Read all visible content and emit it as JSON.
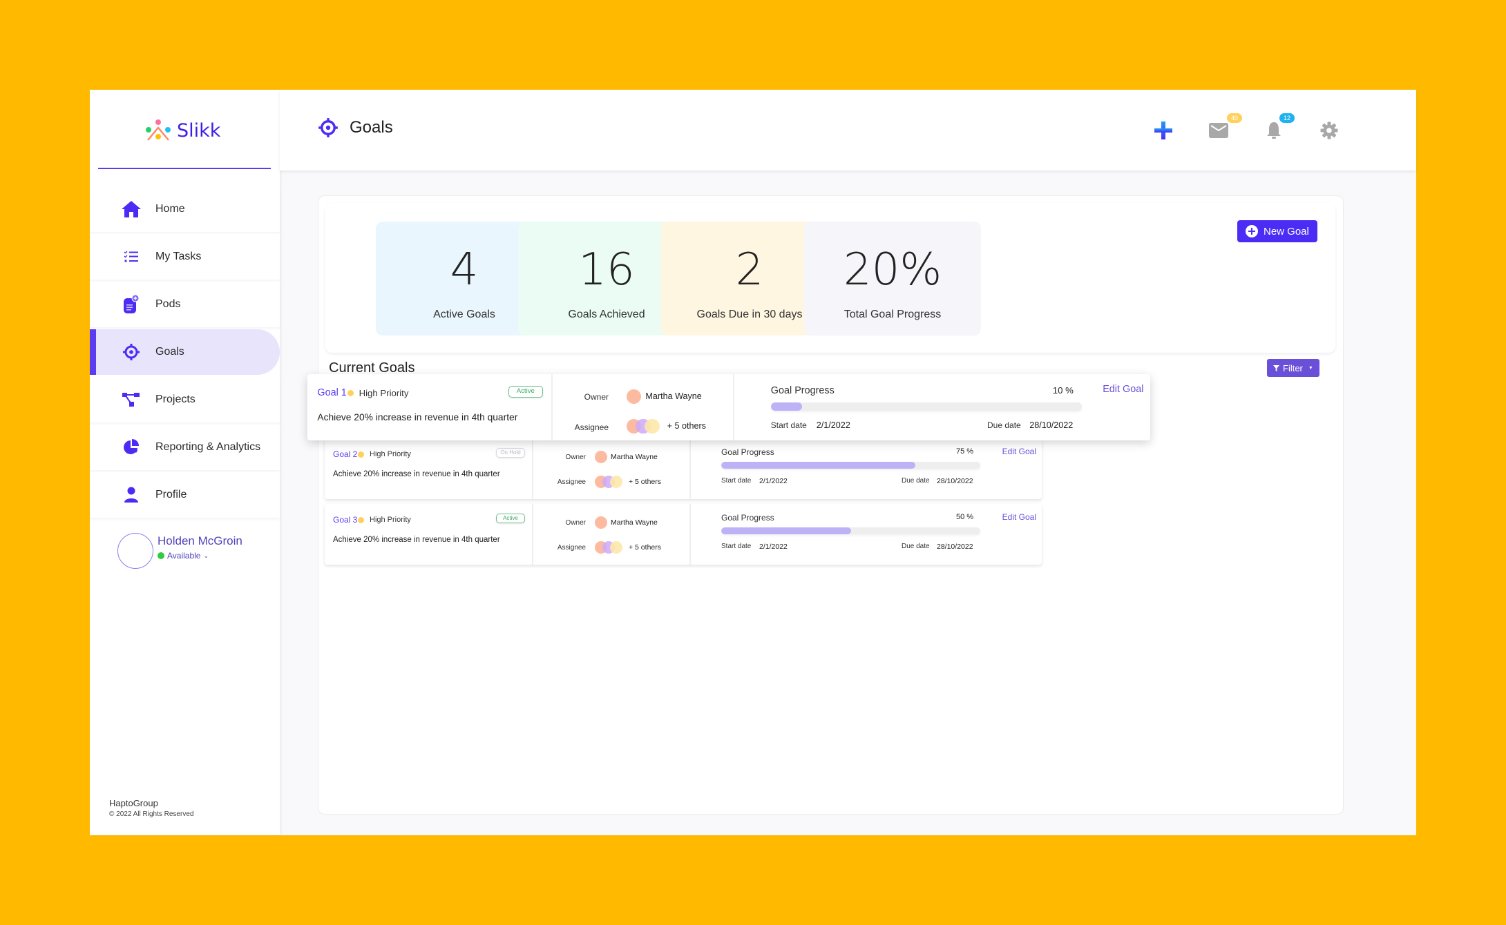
{
  "brand": {
    "name": "Slikk"
  },
  "sidebar": {
    "items": [
      {
        "label": "Home",
        "icon": "home-icon",
        "active": false
      },
      {
        "label": "My Tasks",
        "icon": "task-list-icon",
        "active": false
      },
      {
        "label": "Pods",
        "icon": "pods-icon",
        "active": false
      },
      {
        "label": "Goals",
        "icon": "target-icon",
        "active": true
      },
      {
        "label": "Projects",
        "icon": "hierarchy-icon",
        "active": false
      },
      {
        "label": "Reporting & Analytics",
        "icon": "pie-chart-icon",
        "active": false
      },
      {
        "label": "Profile",
        "icon": "person-icon",
        "active": false
      }
    ],
    "user": {
      "name": "Holden McGroin",
      "status": "Available",
      "status_color": "#2ECC40"
    },
    "footer": {
      "org": "HaptoGroup",
      "copyright": "2022 All Rights Reserved"
    }
  },
  "header": {
    "title": "Goals",
    "mail_badge": "40",
    "notifications_badge": "12"
  },
  "stats": [
    {
      "value": "4",
      "label": "Active Goals",
      "bg": "#EAF6FD"
    },
    {
      "value": "16",
      "label": "Goals Achieved",
      "bg": "#EAFCF3"
    },
    {
      "value": "2",
      "label": "Goals Due in 30 days",
      "bg": "#FEF6E0"
    },
    {
      "value": "20%",
      "label": "Total Goal Progress",
      "bg": "#F5F5FA"
    }
  ],
  "new_goal_label": "New Goal",
  "current_goals": {
    "title": "Current Goals",
    "filter_label": "Filter",
    "owner_label": "Owner",
    "assignee_label": "Assignee",
    "progress_label": "Goal Progress",
    "start_label": "Start date",
    "due_label": "Due date",
    "edit_label": "Edit Goal",
    "goals": [
      {
        "name": "Goal 1",
        "priority": "High Priority",
        "status": "Active",
        "description": "Achieve 20% increase in revenue in 4th quarter",
        "owner": "Martha Wayne",
        "assignees_more": "+ 5 others",
        "progress": 10,
        "progress_text": "10 %",
        "start_date": "2/1/2022",
        "due_date": "28/10/2022"
      },
      {
        "name": "Goal 2",
        "priority": "High Priority",
        "status": "On Hold",
        "description": "Achieve 20% increase in revenue in 4th quarter",
        "owner": "Martha Wayne",
        "assignees_more": "+ 5 others",
        "progress": 75,
        "progress_text": "75 %",
        "start_date": "2/1/2022",
        "due_date": "28/10/2022"
      },
      {
        "name": "Goal 3",
        "priority": "High Priority",
        "status": "Active",
        "description": "Achieve 20% increase in revenue in 4th quarter",
        "owner": "Martha Wayne",
        "assignees_more": "+ 5 others",
        "progress": 50,
        "progress_text": "50 %",
        "start_date": "2/1/2022",
        "due_date": "28/10/2022"
      }
    ]
  },
  "colors": {
    "accent": "#5B3CF0",
    "background": "#FFBA00",
    "progress_fill": "#BEB2F7"
  }
}
